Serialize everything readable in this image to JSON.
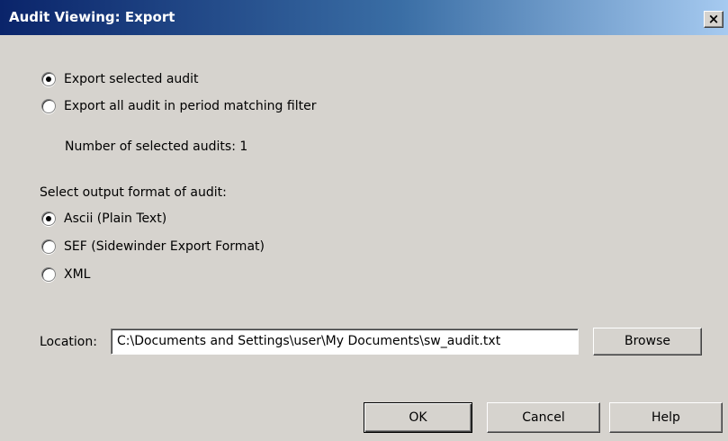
{
  "window": {
    "title": "Audit Viewing: Export",
    "close_label": "×"
  },
  "export_scope": {
    "options": [
      {
        "label": "Export selected audit",
        "checked": true
      },
      {
        "label": "Export all audit in period matching filter",
        "checked": false
      }
    ],
    "selected_count_text": "Number of selected audits: 1"
  },
  "output_format": {
    "heading": "Select output format of audit:",
    "options": [
      {
        "label": "Ascii (Plain Text)",
        "checked": true
      },
      {
        "label": "SEF (Sidewinder Export Format)",
        "checked": false
      },
      {
        "label": "XML",
        "checked": false
      }
    ]
  },
  "location": {
    "label": "Location:",
    "value": "C:\\Documents and Settings\\user\\My Documents\\sw_audit.txt",
    "browse_label": "Browse"
  },
  "buttons": {
    "ok_label": "OK",
    "cancel_label": "Cancel",
    "help_label": "Help"
  }
}
